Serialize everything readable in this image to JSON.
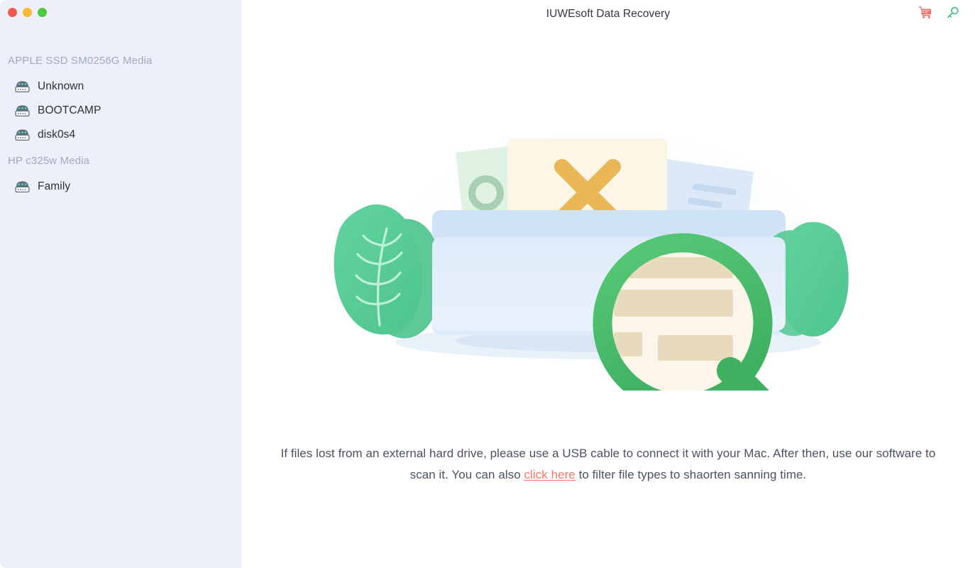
{
  "window": {
    "title": "IUWEsoft Data Recovery",
    "traffic_lights": [
      {
        "name": "close",
        "color": "#F5584D"
      },
      {
        "name": "minimize",
        "color": "#F8BB33"
      },
      {
        "name": "maximize",
        "color": "#4CC93E"
      }
    ]
  },
  "titlebar": {
    "actions": [
      {
        "name": "cart-icon",
        "label": "Buy Now",
        "color": "#E8736A"
      },
      {
        "name": "key-icon",
        "label": "Register",
        "color": "#4CBE8A"
      }
    ]
  },
  "sidebar": {
    "groups": [
      {
        "heading": "APPLE SSD SM0256G Media",
        "items": [
          {
            "label": "Unknown",
            "icon": "drive-icon"
          },
          {
            "label": "BOOTCAMP",
            "icon": "drive-icon"
          },
          {
            "label": "disk0s4",
            "icon": "drive-icon"
          }
        ]
      },
      {
        "heading": "HP c325w Media",
        "items": [
          {
            "label": "Family",
            "icon": "drive-icon"
          }
        ]
      }
    ]
  },
  "main": {
    "illustration": {
      "name": "folder-search-illustration",
      "colors": {
        "folder": "#D6E6F7",
        "folder_front": "#DCEAF9",
        "doc_cream": "#FCF6E6",
        "doc_green": "#DFF2E3",
        "cross": "#E9B755",
        "leaf": "#59CE9A",
        "magnifier": "#4CBE6C",
        "shadow": "#DCE8F7"
      }
    },
    "hint": {
      "text_before": "If files lost from an external hard drive, please use a USB cable to connect it with your Mac. After then, use our software to scan it. You can also ",
      "link": "click here",
      "text_after": " to filter file types to shaorten sanning time.",
      "link_color": "#F4776A"
    }
  },
  "theme": {
    "sidebar_bg": "#EDF0FB",
    "main_bg": "#FFFFFF",
    "heading_color": "#A0A9C2",
    "label_color": "#2B2F38",
    "hint_color": "#4A5160"
  }
}
